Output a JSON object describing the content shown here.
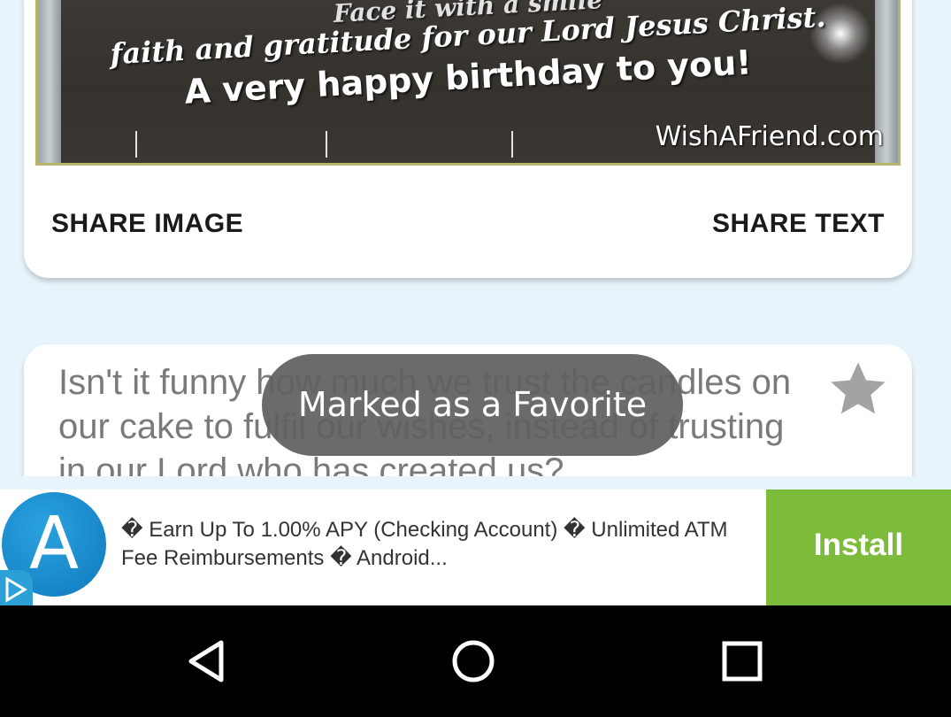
{
  "image_card": {
    "greeting_lines": [
      "Face it with a smile",
      "faith and gratitude for our Lord Jesus Christ.",
      "A very happy birthday to you!"
    ],
    "watermark": "WishAFriend.com",
    "share_image_label": "SHARE IMAGE",
    "share_text_label": "SHARE TEXT"
  },
  "quote_card": {
    "text": "Isn't it funny how much we trust the candles on our cake to fulfil our wishes, instead of trusting in our Lord who has created us?",
    "favorite_icon": "star-icon"
  },
  "toast": {
    "message": "Marked as a Favorite"
  },
  "ad": {
    "logo_letter": "A",
    "text": "� Earn Up To 1.00% APY (Checking Account) � Unlimited ATM Fee Reimbursements � Android...",
    "install_label": "Install",
    "colors": {
      "install": "#7dbb3a",
      "logo": "#1a8fd0"
    }
  },
  "nav": {
    "back_icon": "back-triangle-icon",
    "home_icon": "home-circle-icon",
    "recents_icon": "recents-square-icon"
  }
}
